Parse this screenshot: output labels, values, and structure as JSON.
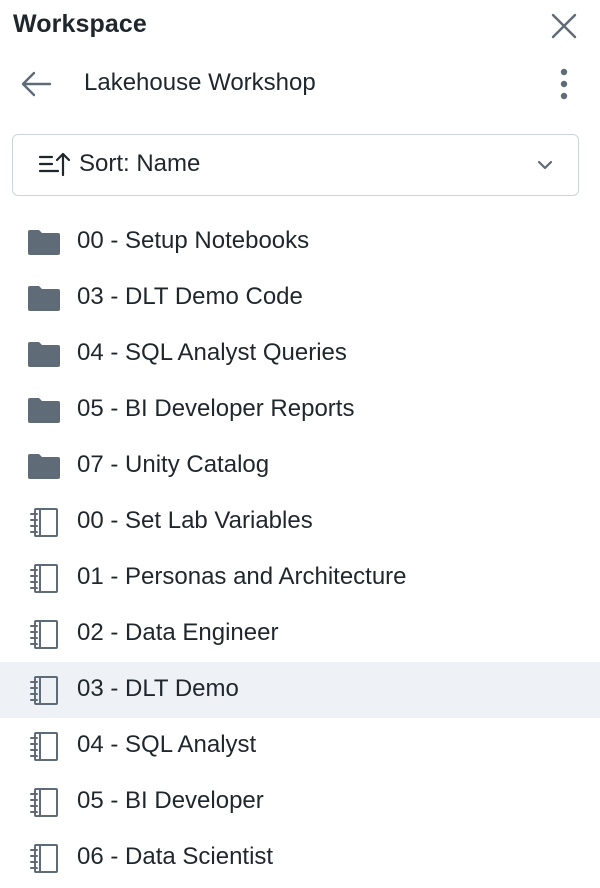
{
  "header": {
    "title": "Workspace"
  },
  "nav": {
    "folder_title": "Lakehouse Workshop"
  },
  "sort": {
    "label": "Sort: Name"
  },
  "items": [
    {
      "label": "00 - Setup Notebooks",
      "type": "folder",
      "selected": false
    },
    {
      "label": "03 - DLT Demo Code",
      "type": "folder",
      "selected": false
    },
    {
      "label": "04 - SQL Analyst Queries",
      "type": "folder",
      "selected": false
    },
    {
      "label": "05 - BI Developer Reports",
      "type": "folder",
      "selected": false
    },
    {
      "label": "07 - Unity Catalog",
      "type": "folder",
      "selected": false
    },
    {
      "label": "00 - Set Lab Variables",
      "type": "notebook",
      "selected": false
    },
    {
      "label": "01 - Personas and Architecture",
      "type": "notebook",
      "selected": false
    },
    {
      "label": "02 - Data Engineer",
      "type": "notebook",
      "selected": false
    },
    {
      "label": "03 - DLT Demo",
      "type": "notebook",
      "selected": true
    },
    {
      "label": "04 - SQL Analyst",
      "type": "notebook",
      "selected": false
    },
    {
      "label": "05 - BI Developer",
      "type": "notebook",
      "selected": false
    },
    {
      "label": "06 - Data Scientist",
      "type": "notebook",
      "selected": false
    }
  ],
  "colors": {
    "text": "#1f272d",
    "icon": "#5f6b76",
    "selected_row": "#eef1f5",
    "border": "#cdd4da"
  }
}
